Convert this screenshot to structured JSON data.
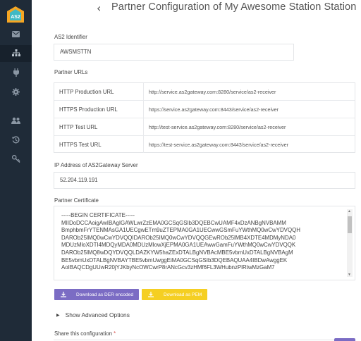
{
  "page": {
    "back_glyph": "‹",
    "title": "Partner Configuration of My Awesome Station Station"
  },
  "sidebar": {
    "logo_text": "AS2",
    "items": [
      {
        "icon": "mail-icon",
        "active": false
      },
      {
        "icon": "sitemap-icon",
        "active": true
      },
      {
        "icon": "plug-icon",
        "active": false
      },
      {
        "icon": "gear-icon",
        "active": false
      },
      {
        "icon": "users-icon",
        "active": false
      },
      {
        "icon": "history-icon",
        "active": false
      },
      {
        "icon": "key-icon",
        "active": false
      }
    ]
  },
  "as2_identifier": {
    "label": "AS2 Identifier",
    "value": "AWSMSTTN"
  },
  "partner_urls": {
    "label": "Partner URLs",
    "rows": [
      {
        "name": "HTTP Production URL",
        "value": "http://service.as2gateway.com:8280/service/as2-receiver"
      },
      {
        "name": "HTTPS Production URL",
        "value": "https://service.as2gateway.com:8443/service/as2-receiver"
      },
      {
        "name": "HTTP Test URL",
        "value": "http://test-service.as2gateway.com:8280/service/as2-receiver"
      },
      {
        "name": "HTTPS Test URL",
        "value": "https://test-service.as2gateway.com:8443/service/as2-receiver"
      }
    ]
  },
  "ip_address": {
    "label": "IP Address of AS2Gateway Server",
    "value": "52.204.119.191"
  },
  "certificate": {
    "label": "Partner Certificate",
    "lines": [
      "-----BEGIN CERTIFICATE-----",
      "MIIDoDCCAoigAwIBAgIGAWLwrZzEMA0GCSqGSIb3DQEBCwUAMF4xDzANBgNVBAMM",
      "BmphbmFrYTENMAsGA1UECgwETm9uZTEPMA0GA1UECwwGSmFuYWthMQ0wCwYDVQQH",
      "DAROb25lMQ0wCwYDVQQIDAROb25lMQ0wCwYDVQQGEwROb25lMB4XDTE4MDMyNDA0",
      "MDUzMloXDTI4MDQyMDA0MDUzMlowXjEPMA0GA1UEAwwGamFuYWthMQ0wCwYDVQQK",
      "DAROb25lMQ8wDQYDVQQLDAZKYW5haZExDTALBgNVBAcMBE5vbmUxDTALBgNVBAgM",
      "BE5vbmUxDTALBgNVBAYTBE5vbmUwggEiMA0GCSqGSIb3DQEBAQUAA4IBDwAwggEK",
      "AoIBAQCDgUUwR20jYJKbyNcOWCwrP8rANcGcv3zHMf6FL3WHubnzPlRtwMzGaM7"
    ]
  },
  "buttons": {
    "der": "Download as DER encoded",
    "pem": "Download as PEM"
  },
  "advanced": {
    "label": "Show Advanced Options"
  },
  "share": {
    "label": "Share this configuration",
    "required_mark": "*"
  },
  "colors": {
    "sidebar_bg": "#1f2b38",
    "der_button": "#7b6cc4",
    "pem_button": "#f5cf22",
    "logo_orange": "#f5a623",
    "logo_teal": "#3fb9c5"
  }
}
